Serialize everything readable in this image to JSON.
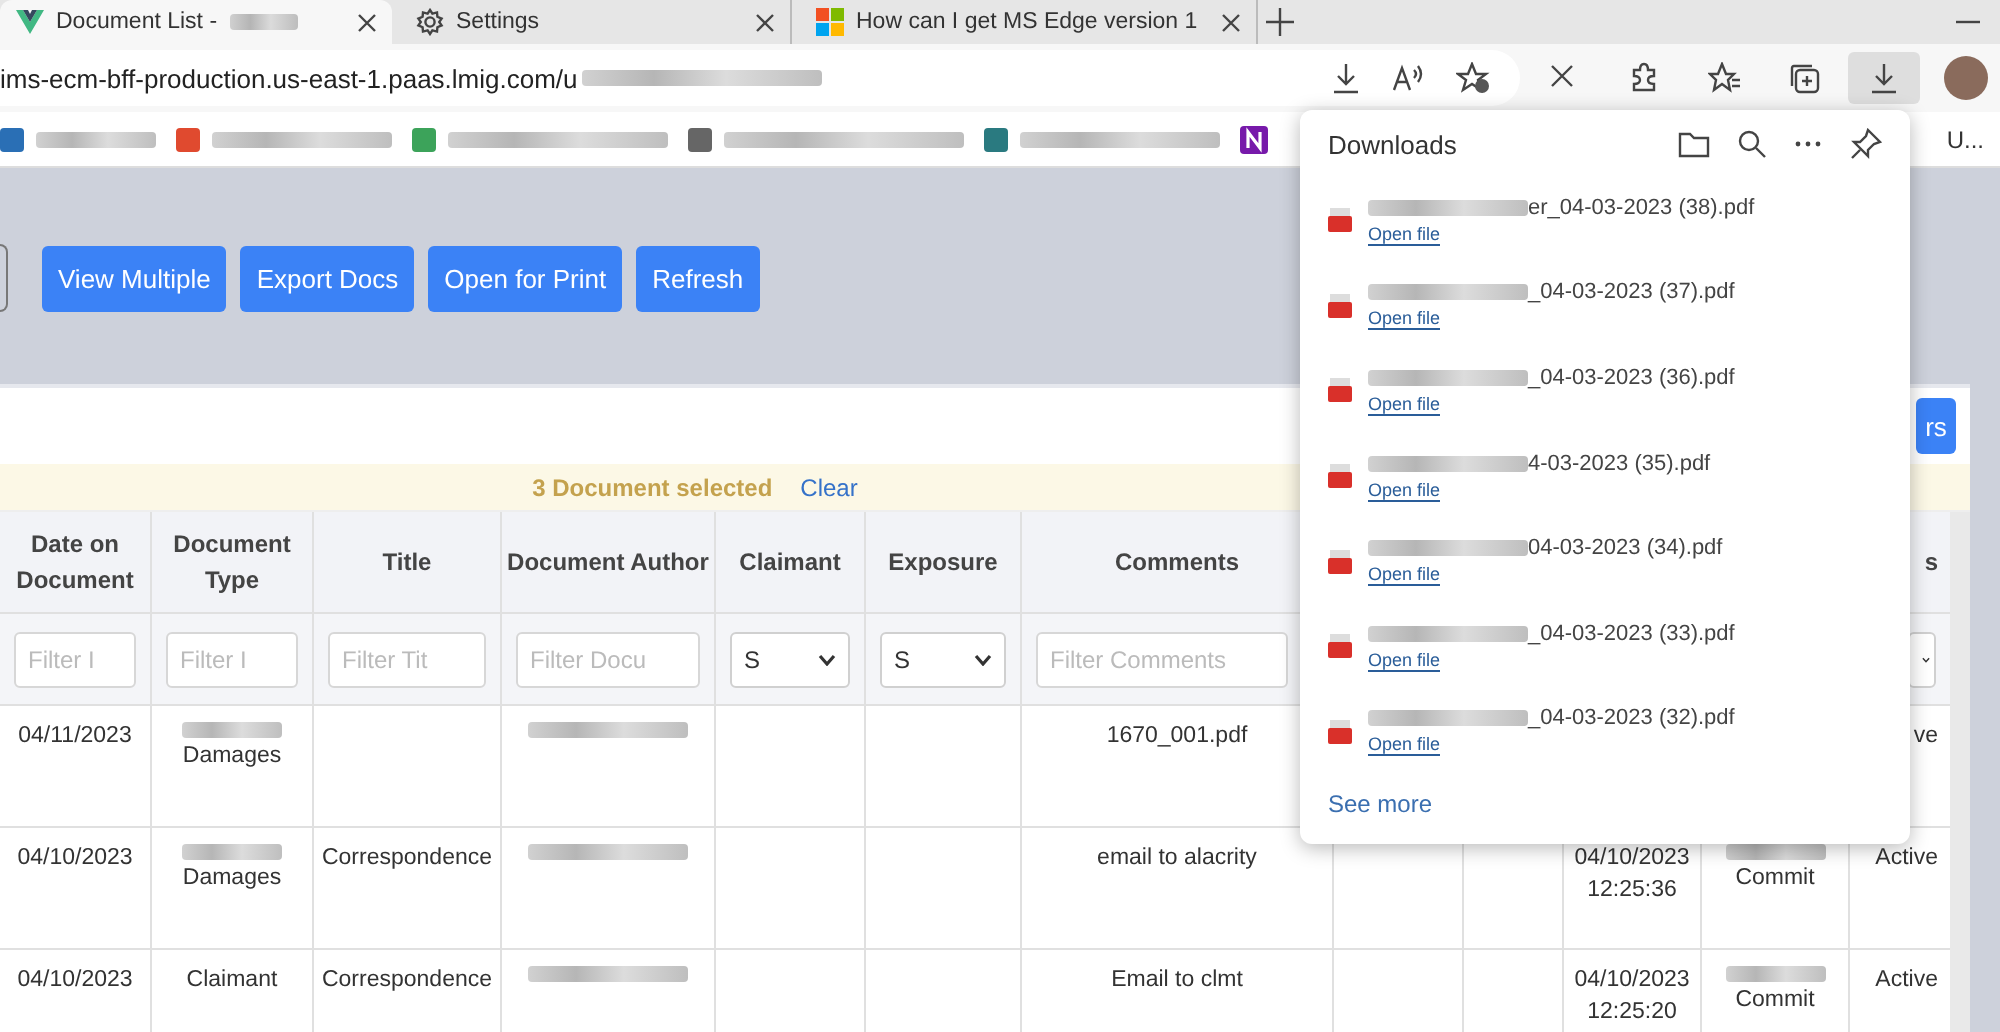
{
  "browser": {
    "tabs": [
      {
        "title": "Document List -",
        "selected": true,
        "blurred": true
      },
      {
        "title": "Settings",
        "selected": false
      },
      {
        "title": "How can I get MS Edge version 1",
        "selected": false
      }
    ],
    "address_bar": {
      "url": "ims-ecm-bff-production.us-east-1.paas.lmig.com/u"
    },
    "bookmarks_overflow": "U..."
  },
  "toolbar": {
    "buttons": [
      "View Multiple",
      "Export Docs",
      "Open for Print",
      "Refresh"
    ],
    "side_button": "rs"
  },
  "selection_banner": {
    "text": "3 Document selected",
    "link": "Clear"
  },
  "table": {
    "columns": [
      {
        "label": "Date on Document",
        "filter": {
          "kind": "text",
          "placeholder": "Filter I"
        }
      },
      {
        "label": "Document Type",
        "filter": {
          "kind": "text",
          "placeholder": "Filter I"
        }
      },
      {
        "label": "Title",
        "filter": {
          "kind": "text",
          "placeholder": "Filter Tit"
        }
      },
      {
        "label": "Document Author",
        "filter": {
          "kind": "text",
          "placeholder": "Filter Docu"
        }
      },
      {
        "label": "Claimant",
        "filter": {
          "kind": "select",
          "value": "S"
        }
      },
      {
        "label": "Exposure",
        "filter": {
          "kind": "select",
          "value": "S"
        }
      },
      {
        "label": "Comments",
        "filter": {
          "kind": "text",
          "placeholder": "Filter Comments"
        }
      },
      {},
      {},
      {},
      {},
      {
        "label": "s",
        "filter": {
          "kind": "select"
        }
      }
    ],
    "rows": [
      {
        "cells": [
          {
            "lines": [
              "04/11/2023"
            ]
          },
          {
            "lines": [
              "Damages"
            ],
            "blurred": true
          },
          {},
          {
            "blurred": true
          },
          {},
          {},
          {
            "lines": [
              "1670_001.pdf"
            ]
          },
          {},
          {},
          {},
          {},
          {
            "lines": [
              "ve"
            ]
          }
        ]
      },
      {
        "cells": [
          {
            "lines": [
              "04/10/2023"
            ]
          },
          {
            "lines": [
              "Damages"
            ],
            "blurred": true
          },
          {
            "lines": [
              "Correspondence"
            ]
          },
          {
            "blurred": true
          },
          {},
          {},
          {
            "lines": [
              "email to alacrity"
            ]
          },
          {},
          {},
          {
            "lines": [
              "04/10/2023",
              "12:25:36"
            ]
          },
          {
            "lines": [
              "Commit"
            ],
            "blurred": true
          },
          {
            "lines": [
              "Active"
            ]
          }
        ]
      },
      {
        "cells": [
          {
            "lines": [
              "04/10/2023"
            ]
          },
          {
            "lines": [
              "Claimant"
            ]
          },
          {
            "lines": [
              "Correspondence"
            ]
          },
          {
            "blurred": true
          },
          {},
          {},
          {
            "lines": [
              "Email to clmt"
            ]
          },
          {},
          {},
          {
            "lines": [
              "04/10/2023",
              "12:25:20"
            ]
          },
          {
            "lines": [
              "Commit"
            ],
            "blurred": true
          },
          {
            "lines": [
              "Active"
            ]
          }
        ]
      }
    ]
  },
  "downloads": {
    "title": "Downloads",
    "items": [
      {
        "name": "er_04-03-2023 (38).pdf",
        "action": "Open file"
      },
      {
        "name": "_04-03-2023 (37).pdf",
        "action": "Open file"
      },
      {
        "name": "_04-03-2023 (36).pdf",
        "action": "Open file"
      },
      {
        "name": "4-03-2023 (35).pdf",
        "action": "Open file"
      },
      {
        "name": "04-03-2023 (34).pdf",
        "action": "Open file"
      },
      {
        "name": "_04-03-2023 (33).pdf",
        "action": "Open file"
      },
      {
        "name": "_04-03-2023 (32).pdf",
        "action": "Open file"
      }
    ],
    "see_more": "See more"
  }
}
